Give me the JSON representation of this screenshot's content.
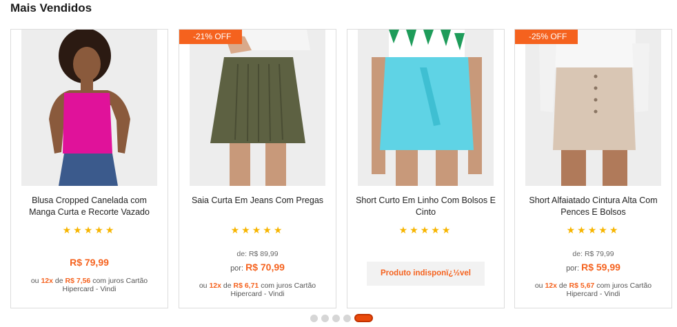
{
  "section": {
    "title": "Mais Vendidos"
  },
  "products": [
    {
      "badge": "",
      "name_line1": "Blusa Cropped Canelada com",
      "name_line2": "Manga Curta e Recorte Vazado",
      "rating_stars": "★★★★★",
      "old_price_label": "",
      "old_price": "",
      "price_label": "",
      "price": "R$ 79,99",
      "inst_prefix": "ou",
      "inst_count": "12x",
      "inst_mid": "de",
      "inst_value": "R$ 7,56",
      "inst_suffix": "com juros Cartão",
      "inst_line2": "Hipercard - Vindi",
      "unavailable": ""
    },
    {
      "badge": "-21% OFF",
      "name_line1": "Saia Curta Em Jeans Com Pregas",
      "name_line2": "",
      "rating_stars": "★★★★★",
      "old_price_label": "de:",
      "old_price": "R$ 89,99",
      "price_label": "por:",
      "price": "R$ 70,99",
      "inst_prefix": "ou",
      "inst_count": "12x",
      "inst_mid": "de",
      "inst_value": "R$ 6,71",
      "inst_suffix": "com juros Cartão",
      "inst_line2": "Hipercard - Vindi",
      "unavailable": ""
    },
    {
      "badge": "",
      "name_line1": "Short Curto Em Linho Com Bolsos E",
      "name_line2": "Cinto",
      "rating_stars": "★★★★★",
      "unavailable": "Produto indisponï¿½vel"
    },
    {
      "badge": "-25% OFF",
      "name_line1": "Short Alfaiatado Cintura Alta Com",
      "name_line2": "Pences E Bolsos",
      "rating_stars": "★★★★★",
      "old_price_label": "de:",
      "old_price": "R$ 79,99",
      "price_label": "por:",
      "price": "R$ 59,99",
      "inst_prefix": "ou",
      "inst_count": "12x",
      "inst_mid": "de",
      "inst_value": "R$ 5,67",
      "inst_suffix": "com juros Cartão",
      "inst_line2": "Hipercard - Vindi",
      "unavailable": ""
    }
  ],
  "carousel": {
    "page_count": 5,
    "active_page": 5
  },
  "colors": {
    "accent": "#f5621e",
    "star": "#f7b500",
    "border": "#dcdcdc",
    "dot": "#d6d6d6"
  }
}
